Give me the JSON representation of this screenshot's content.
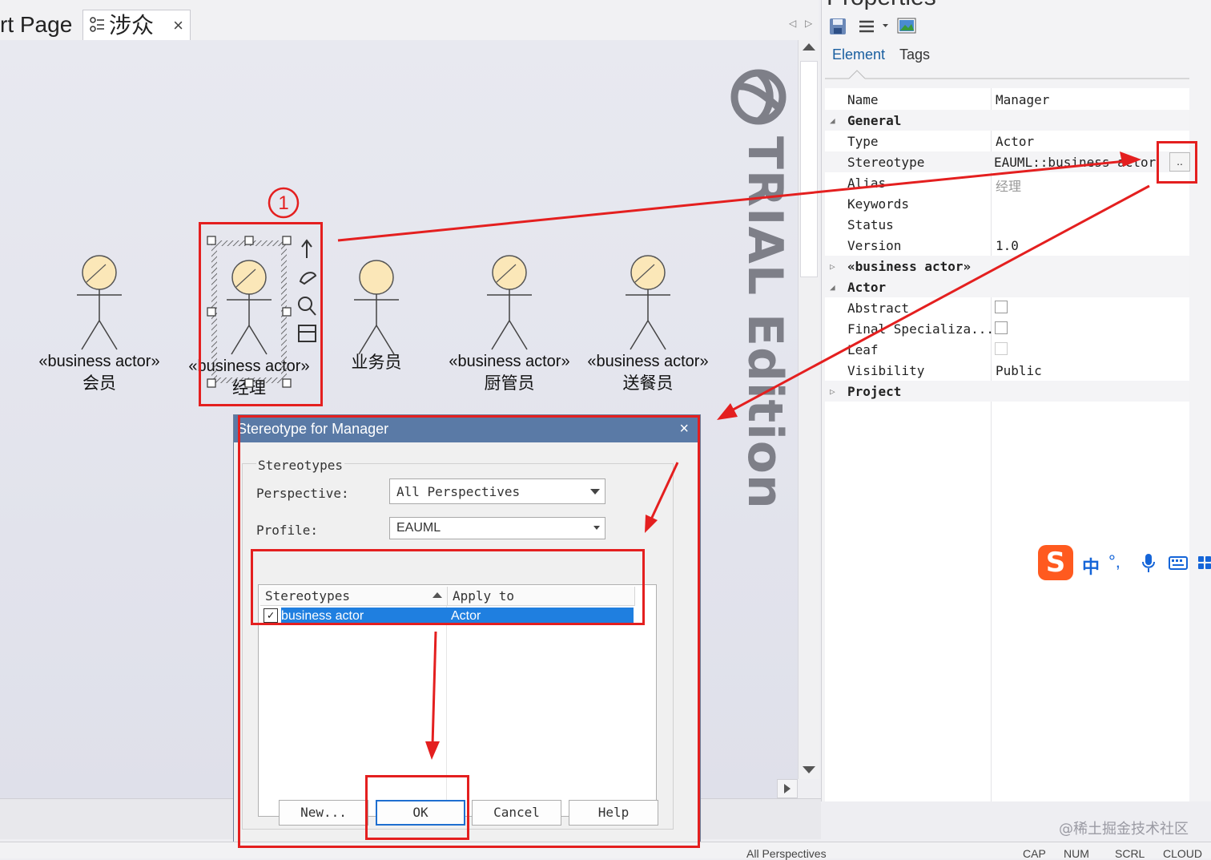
{
  "tabs": {
    "start": "rt Page",
    "diagram": "涉众",
    "close": "×"
  },
  "canvas": {
    "watermark": "TRIAL Edition",
    "actors": [
      {
        "stereotype": "«business actor»",
        "name": "会员"
      },
      {
        "stereotype": "«business actor»",
        "name": "经理"
      },
      {
        "stereotype": "",
        "name": "业务员"
      },
      {
        "stereotype": "«business actor»",
        "name": "厨管员"
      },
      {
        "stereotype": "«business actor»",
        "name": "送餐员"
      }
    ]
  },
  "annotation": {
    "step": "1"
  },
  "properties": {
    "title": "Properties",
    "tabs": [
      "Element",
      "Tags"
    ],
    "rows": {
      "name_k": "Name",
      "name_v": "Manager",
      "general": "General",
      "type_k": "Type",
      "type_v": "Actor",
      "stereotype_k": "Stereotype",
      "stereotype_v": "EAUML::business actor",
      "alias_k": "Alias",
      "alias_v": "经理",
      "keywords_k": "Keywords",
      "status_k": "Status",
      "version_k": "Version",
      "version_v": "1.0",
      "business_actor": "«business actor»",
      "actor": "Actor",
      "abstract_k": "Abstract",
      "final_k": "Final Specializa...",
      "leaf_k": "Leaf",
      "visibility_k": "Visibility",
      "visibility_v": "Public",
      "project": "Project"
    },
    "ellipsis": ".."
  },
  "dialog": {
    "title": "Stereotype for Manager",
    "close": "×",
    "group": "Stereotypes",
    "perspective_label": "Perspective:",
    "perspective_value": "All Perspectives",
    "profile_label": "Profile:",
    "profile_value": "EAUML",
    "list_headers": [
      "Stereotypes",
      "Apply to"
    ],
    "list_rows": [
      {
        "checked": true,
        "stereotype": "business actor",
        "apply_to": "Actor"
      }
    ],
    "buttons": {
      "new": "New...",
      "ok": "OK",
      "cancel": "Cancel",
      "help": "Help"
    }
  },
  "ime": {
    "logo": "S",
    "lang": "中",
    "punct": "°,"
  },
  "status": {
    "perspective": "All Perspectives",
    "caps": "CAP",
    "num": "NUM",
    "scrl": "SCRL",
    "cloud": "CLOUD"
  },
  "credit": "@稀土掘金技术社区",
  "colors": {
    "accent": "#1f7fe0",
    "annotation": "#e41f1f",
    "dialog_title": "#5a7aa6"
  }
}
